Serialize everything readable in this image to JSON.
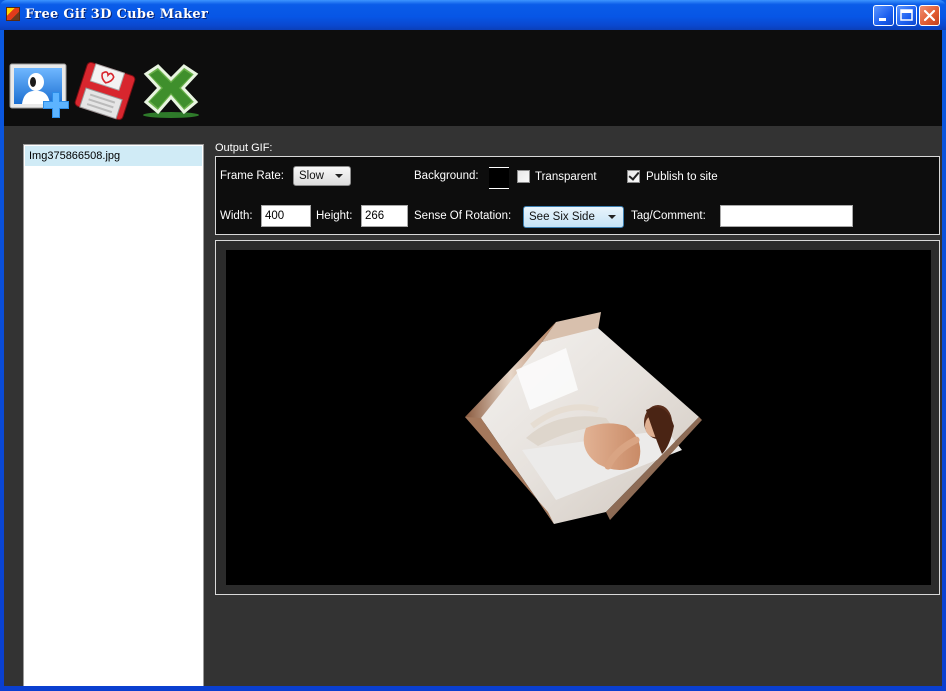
{
  "window": {
    "title": "Free Gif 3D Cube Maker"
  },
  "toolbar": {
    "add_tooltip": "add-image",
    "save_tooltip": "save",
    "remove_tooltip": "remove"
  },
  "files": [
    "Img375866508.jpg"
  ],
  "output": {
    "label": "Output GIF:",
    "frame_rate_label": "Frame Rate:",
    "frame_rate_value": "Slow",
    "background_label": "Background:",
    "background_color": "#000000",
    "transparent_label": "Transparent",
    "transparent_checked": false,
    "publish_label": "Publish to site",
    "publish_checked": true,
    "width_label": "Width:",
    "width_value": "400",
    "height_label": "Height:",
    "height_value": "266",
    "rotation_label": "Sense Of Rotation:",
    "rotation_value": "See Six Side",
    "tag_label": "Tag/Comment:",
    "tag_value": ""
  },
  "colors": {
    "titlebar": "#0a5ce8",
    "client_bg": "#333333",
    "toolbar_bg": "#0d0d0d",
    "selected_item": "#d0ebf6"
  }
}
